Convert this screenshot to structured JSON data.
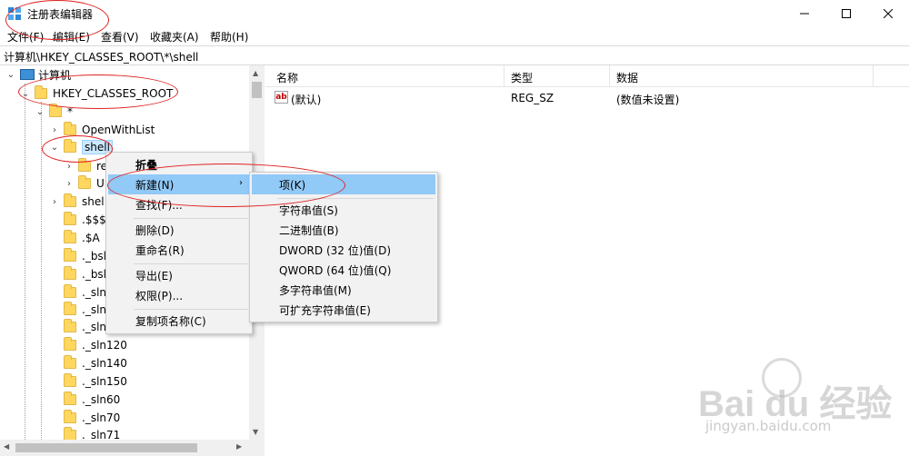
{
  "window": {
    "title": "注册表编辑器",
    "minimize_icon": "minimize-icon",
    "maximize_icon": "maximize-icon",
    "close_icon": "close-icon"
  },
  "menubar": {
    "items": [
      "文件(F)",
      "编辑(E)",
      "查看(V)",
      "收藏夹(A)",
      "帮助(H)"
    ]
  },
  "address": {
    "path": "计算机\\HKEY_CLASSES_ROOT\\*\\shell"
  },
  "tree": {
    "root": "计算机",
    "hkcr": "HKEY_CLASSES_ROOT",
    "star": "*",
    "openwithlist": "OpenWithList",
    "shell": "shell",
    "shell_child1": "re",
    "shell_child2": "U",
    "shellex": "shel",
    "items": [
      ".$$$",
      ".$A",
      "._bsln14",
      "._bsln1",
      "._sln",
      "._sln100",
      "._sln110",
      "._sln120",
      "._sln140",
      "._sln150",
      "._sln60",
      "._sln70",
      "._sln71"
    ]
  },
  "list": {
    "headers": {
      "name": "名称",
      "type": "类型",
      "data": "数据"
    },
    "rows": [
      {
        "name": "(默认)",
        "type": "REG_SZ",
        "data": "(数值未设置)"
      }
    ]
  },
  "context_menu": {
    "collapse": "折叠",
    "new": "新建(N)",
    "find": "查找(F)...",
    "delete": "删除(D)",
    "rename": "重命名(R)",
    "export": "导出(E)",
    "permissions": "权限(P)...",
    "copy_key_name": "复制项名称(C)"
  },
  "submenu": {
    "key": "项(K)",
    "string": "字符串值(S)",
    "binary": "二进制值(B)",
    "dword": "DWORD (32 位)值(D)",
    "qword": "QWORD (64 位)值(Q)",
    "multi_string": "多字符串值(M)",
    "expandable_string": "可扩充字符串值(E)"
  },
  "watermark": {
    "logo": "Bai du 经验",
    "site": "jingyan.baidu.com"
  },
  "colors": {
    "highlight": "#91c9f7",
    "selection": "#cce8ff",
    "annotation": "#e02020"
  }
}
